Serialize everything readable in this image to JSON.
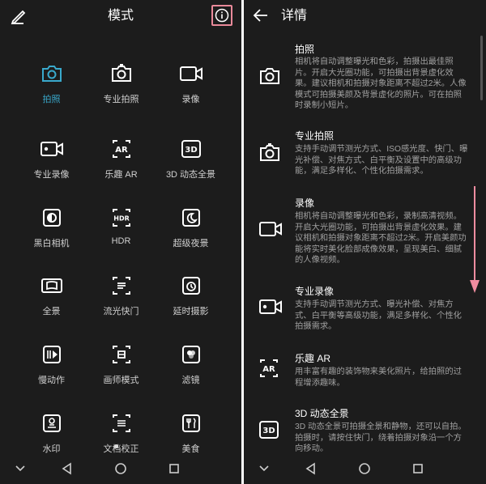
{
  "left": {
    "title": "模式",
    "icons": {
      "edit": "pencil-icon",
      "info": "info-icon"
    },
    "modes": [
      {
        "label": "拍照",
        "icon": "camera-icon",
        "active": true
      },
      {
        "label": "专业拍照",
        "icon": "pro-camera-icon"
      },
      {
        "label": "录像",
        "icon": "video-icon"
      },
      {
        "label": "专业录像",
        "icon": "pro-video-icon"
      },
      {
        "label": "乐趣 AR",
        "icon": "ar-icon"
      },
      {
        "label": "3D 动态全景",
        "icon": "3d-icon"
      },
      {
        "label": "黑白相机",
        "icon": "monochrome-icon"
      },
      {
        "label": "HDR",
        "icon": "hdr-icon"
      },
      {
        "label": "超级夜景",
        "icon": "night-icon"
      },
      {
        "label": "全景",
        "icon": "panorama-icon"
      },
      {
        "label": "流光快门",
        "icon": "light-painting-icon"
      },
      {
        "label": "延时摄影",
        "icon": "timelapse-icon"
      },
      {
        "label": "慢动作",
        "icon": "slow-motion-icon"
      },
      {
        "label": "画师模式",
        "icon": "artist-icon"
      },
      {
        "label": "滤镜",
        "icon": "filter-icon"
      },
      {
        "label": "水印",
        "icon": "watermark-icon"
      },
      {
        "label": "文档校正",
        "icon": "document-icon"
      },
      {
        "label": "美食",
        "icon": "food-icon"
      }
    ],
    "accent": "#39a9cc"
  },
  "right": {
    "title": "详情",
    "items": [
      {
        "title": "拍照",
        "icon": "camera-icon",
        "lines": [
          "相机将自动调整曝光和色彩，拍摄出最佳照",
          "片。开启大光圈功能，可拍摄出背景虚化效",
          "果。建议相机和拍摄对象距离不超过2米。人像",
          "模式可拍摄美颜及背景虚化的照片。可在拍照",
          "时录制小短片。"
        ]
      },
      {
        "title": "专业拍照",
        "icon": "pro-camera-icon",
        "lines": [
          "支持手动调节测光方式、ISO感光度、快门、曝",
          "光补偿、对焦方式、白平衡及设置中的高级功",
          "能，满足多样化、个性化拍摄需求。"
        ]
      },
      {
        "title": "录像",
        "icon": "video-icon",
        "lines": [
          "相机将自动调整曝光和色彩，录制高清视频。",
          "开启大光圈功能，可拍摄出背景虚化效果。建",
          "议相机和拍摄对象距离不超过2米。开启美颜功",
          "能将实时美化脸部成像效果，呈现美白、细腻",
          "的人像视频。"
        ]
      },
      {
        "title": "专业录像",
        "icon": "pro-video-icon",
        "lines": [
          "支持手动调节测光方式、曝光补偿、对焦方",
          "式、白平衡等高级功能，满足多样化、个性化",
          "拍摄需求。"
        ]
      },
      {
        "title": "乐趣 AR",
        "icon": "ar-icon",
        "lines": [
          "用丰富有趣的装饰物来美化照片，给拍照的过",
          "程增添趣味。"
        ]
      },
      {
        "title": "3D 动态全景",
        "icon": "3d-icon",
        "lines": [
          "3D 动态全景可拍摄全景和静物，还可以自拍。",
          "拍摄时，请按住快门，绕着拍摄对象沿一个方",
          "向移动。"
        ]
      }
    ],
    "annotation_color": "#f08ca0"
  },
  "nav": {
    "icons": [
      "chevron-down-icon",
      "back-triangle-icon",
      "home-circle-icon",
      "recents-square-icon"
    ]
  }
}
